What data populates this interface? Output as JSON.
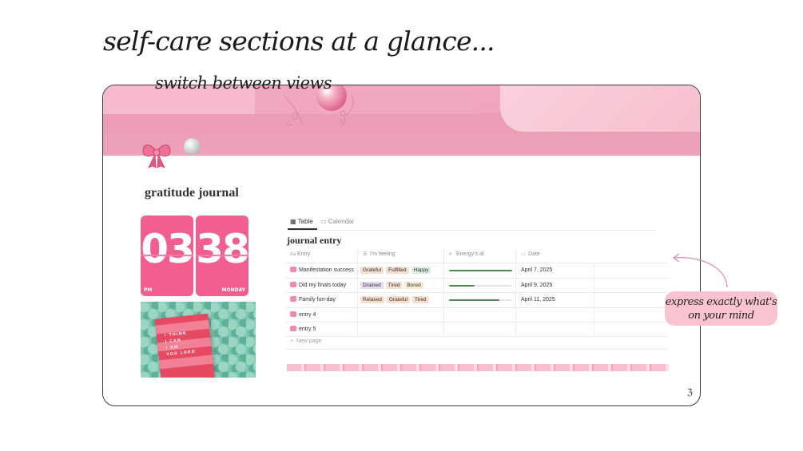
{
  "headline": "self-care sections at a glance...",
  "annotations": {
    "views": "switch between views",
    "mind_line1": "express exactly what's",
    "mind_line2": "on your mind"
  },
  "page": {
    "title": "gratitude journal",
    "icon": "bow-icon"
  },
  "clock": {
    "hours": "03",
    "minutes": "38",
    "ampm": "PM",
    "day": "MONDAY"
  },
  "photo": {
    "book_lines": [
      "I THINK",
      "I CAN",
      "I AM",
      "YOU LORD"
    ]
  },
  "tabs": [
    {
      "label": "Table",
      "icon": "table-icon",
      "active": true
    },
    {
      "label": "Calendar",
      "icon": "calendar-icon",
      "active": false
    }
  ],
  "database": {
    "title": "journal entry",
    "columns": [
      {
        "label": "Entry",
        "icon": "text-icon"
      },
      {
        "label": "I'm feeling",
        "icon": "list-icon"
      },
      {
        "label": "Energy's at",
        "icon": "number-icon"
      },
      {
        "label": "Date",
        "icon": "calendar-icon"
      }
    ],
    "rows": [
      {
        "entry": "Manifestation success",
        "tags": [
          "Grateful",
          "Fulfilled",
          "Happy"
        ],
        "energy": 1.0,
        "date": "April 7, 2025"
      },
      {
        "entry": "Did my finals today",
        "tags": [
          "Drained",
          "Tired",
          "Bored"
        ],
        "energy": 0.4,
        "date": "April 9, 2025"
      },
      {
        "entry": "Family fun-day",
        "tags": [
          "Relaxed",
          "Grateful",
          "Tired"
        ],
        "energy": 0.8,
        "date": "April 11, 2025"
      },
      {
        "entry": "entry 4",
        "tags": [],
        "energy": null,
        "date": ""
      },
      {
        "entry": "entry 5",
        "tags": [],
        "energy": null,
        "date": ""
      }
    ],
    "new_page": "New page"
  },
  "colors": {
    "accent_pink": "#f25f8f",
    "energy_bar": "#4f8a54",
    "tag_grateful": "#f6dfcf",
    "tag_fulfilled": "#f6dfcf",
    "tag_happy": "#dcefe0",
    "tag_drained": "#e6dcf2",
    "tag_tired": "#f6dfcf",
    "tag_bored": "#f7ead0",
    "tag_relaxed": "#f6dfcf"
  }
}
